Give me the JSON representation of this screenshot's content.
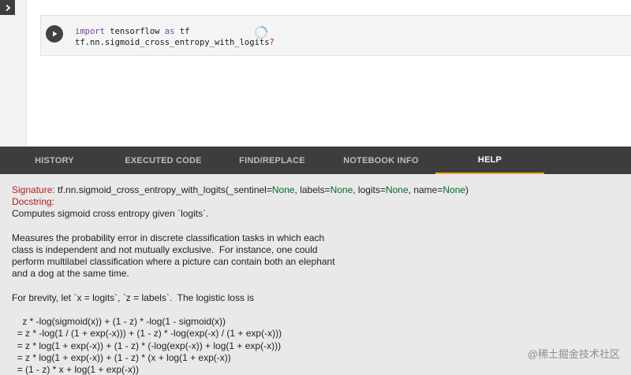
{
  "code_cell": {
    "line1_keyword": "import",
    "line1_rest": " tensorflow ",
    "line1_as": "as",
    "line1_alias": " tf",
    "line2_code": "tf.nn.sigmoid_cross_entropy_with_logits",
    "line2_question": "?"
  },
  "tabs": [
    {
      "label": "HISTORY",
      "active": false
    },
    {
      "label": "EXECUTED CODE",
      "active": false
    },
    {
      "label": "FIND/REPLACE",
      "active": false
    },
    {
      "label": "NOTEBOOK INFO",
      "active": false
    },
    {
      "label": "HELP",
      "active": true
    }
  ],
  "help": {
    "signature_label": "Signature:",
    "signature_prefix": " tf.nn.sigmoid_cross_entropy_with_logits(_sentinel=",
    "none1": "None",
    "sig_part2": ", labels=",
    "none2": "None",
    "sig_part3": ", logits=",
    "none3": "None",
    "sig_part4": ", name=",
    "none4": "None",
    "sig_close": ")",
    "docstring_label": "Docstring:",
    "summary": "Computes sigmoid cross entropy given `logits`.",
    "paragraph": "Measures the probability error in discrete classification tasks in which each\nclass is independent and not mutually exclusive.  For instance, one could\nperform multilabel classification where a picture can contain both an elephant\nand a dog at the same time.",
    "brevity": "For brevity, let `x = logits`, `z = labels`.  The logistic loss is",
    "formula": "    z * -log(sigmoid(x)) + (1 - z) * -log(1 - sigmoid(x))\n  = z * -log(1 / (1 + exp(-x))) + (1 - z) * -log(exp(-x) / (1 + exp(-x)))\n  = z * log(1 + exp(-x)) + (1 - z) * (-log(exp(-x)) + log(1 + exp(-x)))\n  = z * log(1 + exp(-x)) + (1 - z) * (x + log(1 + exp(-x))\n  = (1 - z) * x + log(1 + exp(-x))"
  },
  "watermark": "@稀土掘金技术社区",
  "colors": {
    "tab_bar": "#3d3d3d",
    "active_tab_underline": "#f9a825",
    "help_background": "#e9e9e9",
    "docstring_label": "#b71c1c",
    "none_keyword": "#006d2c"
  }
}
